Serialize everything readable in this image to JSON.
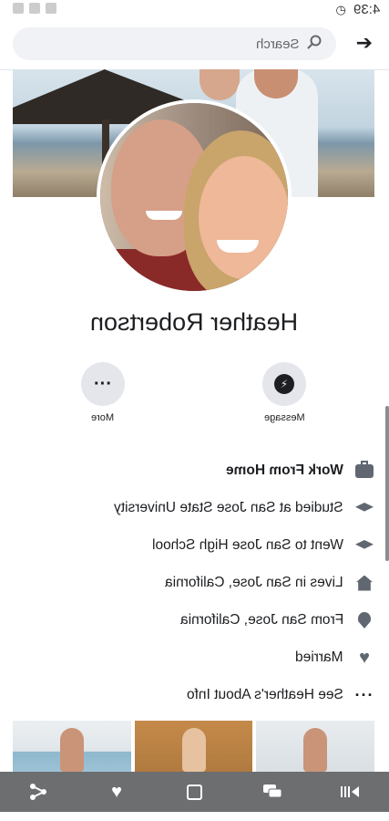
{
  "status_bar": {
    "time": "4:39"
  },
  "search": {
    "placeholder": "Search"
  },
  "profile": {
    "name": "Heather Robertson"
  },
  "actions": {
    "message_label": "Message",
    "more_label": "More"
  },
  "info": [
    {
      "icon": "briefcase-icon",
      "text": "Work From Home"
    },
    {
      "icon": "graduation-cap-icon",
      "text": "Studied at San Jose State University"
    },
    {
      "icon": "graduation-cap-icon",
      "text": "Went to San Jose High School"
    },
    {
      "icon": "home-icon",
      "text": "Lives in San Jose, California"
    },
    {
      "icon": "location-pin-icon",
      "text": "From San Jose, California"
    },
    {
      "icon": "heart-icon",
      "text": "Married"
    },
    {
      "icon": "more-dots-icon",
      "text": "See Heather's About Info"
    }
  ],
  "colors": {
    "nav_bar": "#6d6e70",
    "icon_gray": "#606770",
    "button_bg": "#e4e6eb"
  }
}
